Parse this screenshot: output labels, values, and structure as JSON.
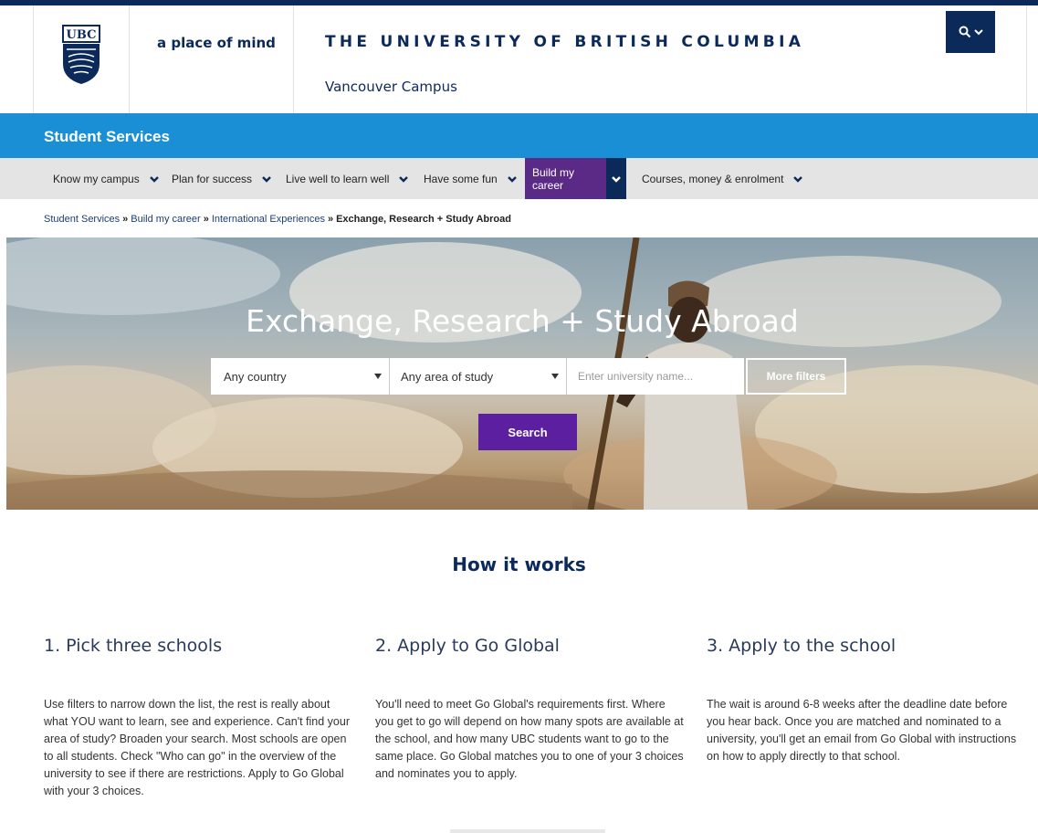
{
  "header": {
    "logo_text": "UBC",
    "tagline": "a place of mind",
    "university_name": "THE UNIVERSITY OF BRITISH COLUMBIA",
    "campus": "Vancouver Campus"
  },
  "unit": {
    "title": "Student Services"
  },
  "nav": {
    "items": [
      {
        "label": "Know my campus"
      },
      {
        "label": "Plan for success"
      },
      {
        "label": "Live well to learn well"
      },
      {
        "label": "Have some fun"
      },
      {
        "label": "Build my career"
      },
      {
        "label": "Courses, money & enrolment"
      }
    ],
    "active_color": "#5b2a86"
  },
  "breadcrumb": {
    "items": [
      "Student Services",
      "Build my career",
      "International Experiences"
    ],
    "separator": "»",
    "current": "Exchange, Research + Study Abroad"
  },
  "hero": {
    "title": "Exchange, Research + Study Abroad",
    "country_select": "Any country",
    "area_select": "Any area of study",
    "university_placeholder": "Enter university name...",
    "more_filters": "More filters",
    "search_button": "Search"
  },
  "how": {
    "title": "How it works",
    "steps": [
      {
        "title": "1. Pick three schools",
        "text": "Use filters to narrow down the list, the rest is really about what YOU want to learn, see and experience. Can't find your area of study? Broaden your search. Most schools are open to all students. Check \"Who can go\" in the overview of the university to see if there are restrictions. Apply to Go Global with your 3 choices."
      },
      {
        "title": "2. Apply to Go Global",
        "text": "You'll need to meet Go Global's requirements first. Where you get to go will depend on how many spots are available at the school, and how many UBC students want to go to the same place. Go Global matches you to one of your 3 choices and nominates you to apply."
      },
      {
        "title": "3. Apply to the school",
        "text": "The wait is around 6-8 weeks after the deadline date before you hear back. Once you are matched and nominated to a university, you'll get an email from Go Global with instructions on how to apply directly to that school."
      }
    ]
  },
  "colors": {
    "navy": "#0b2a5a",
    "blue": "#1a8fd6",
    "purple": "#5b1fa0"
  }
}
